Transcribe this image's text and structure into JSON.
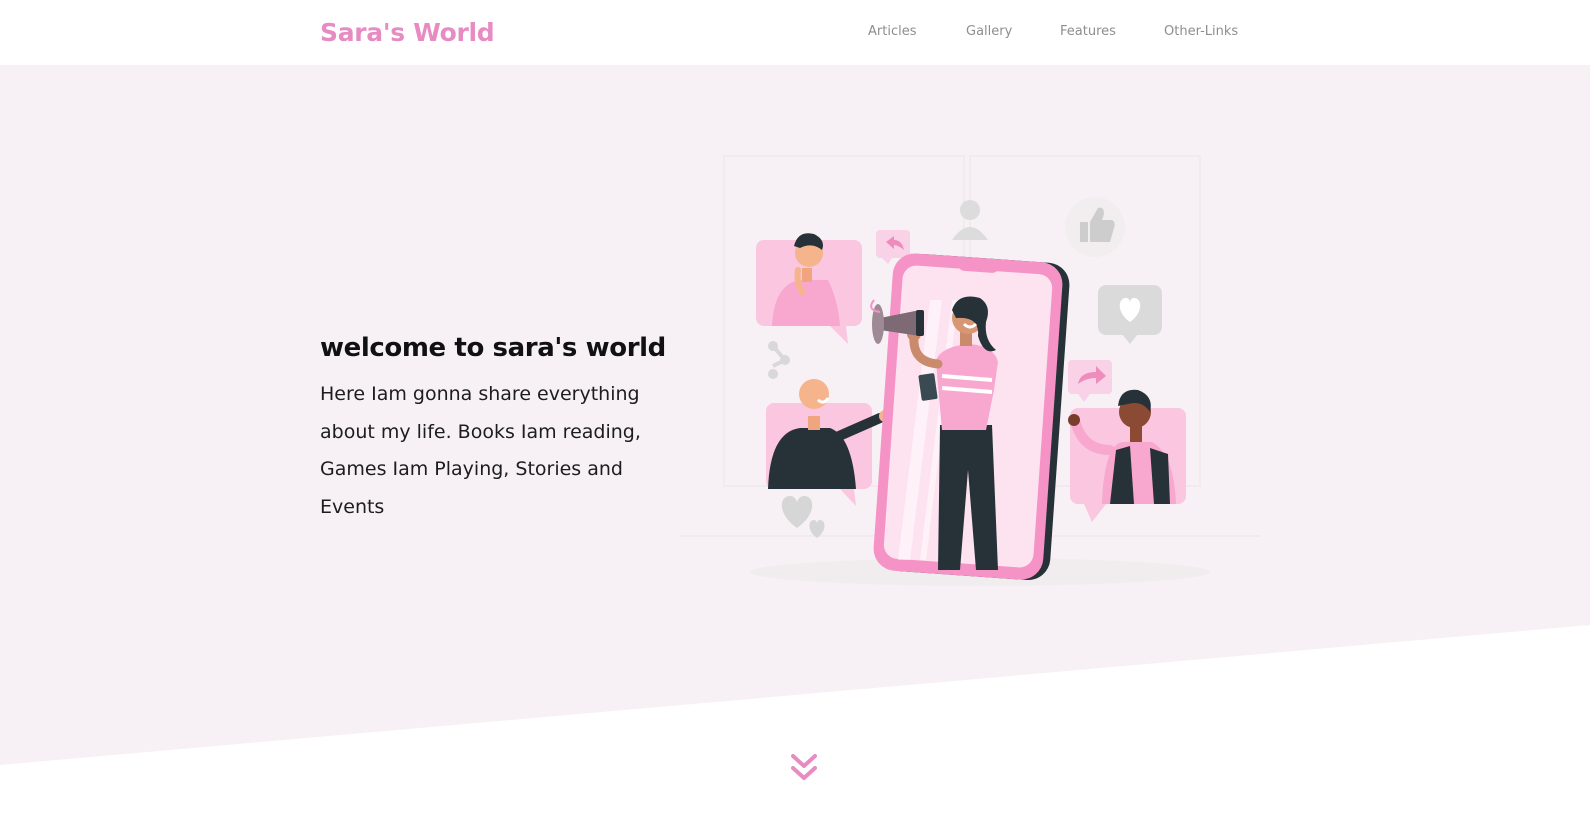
{
  "header": {
    "logo": "Sara's World",
    "nav": [
      {
        "label": "Articles"
      },
      {
        "label": "Gallery"
      },
      {
        "label": "Features"
      },
      {
        "label": "Other-Links"
      }
    ]
  },
  "hero": {
    "title": "welcome to sara's world",
    "text": "Here Iam gonna share everything about my life. Books Iam reading, Games Iam Playing, Stories and Events"
  },
  "colors": {
    "brand_pink": "#e78cc3",
    "hero_bg": "#f7f1f5",
    "nav_text": "#8e8e8e"
  },
  "icons": {
    "scroll": "double-chevron-down-icon",
    "illustration": "social-media-megaphone-illustration"
  }
}
